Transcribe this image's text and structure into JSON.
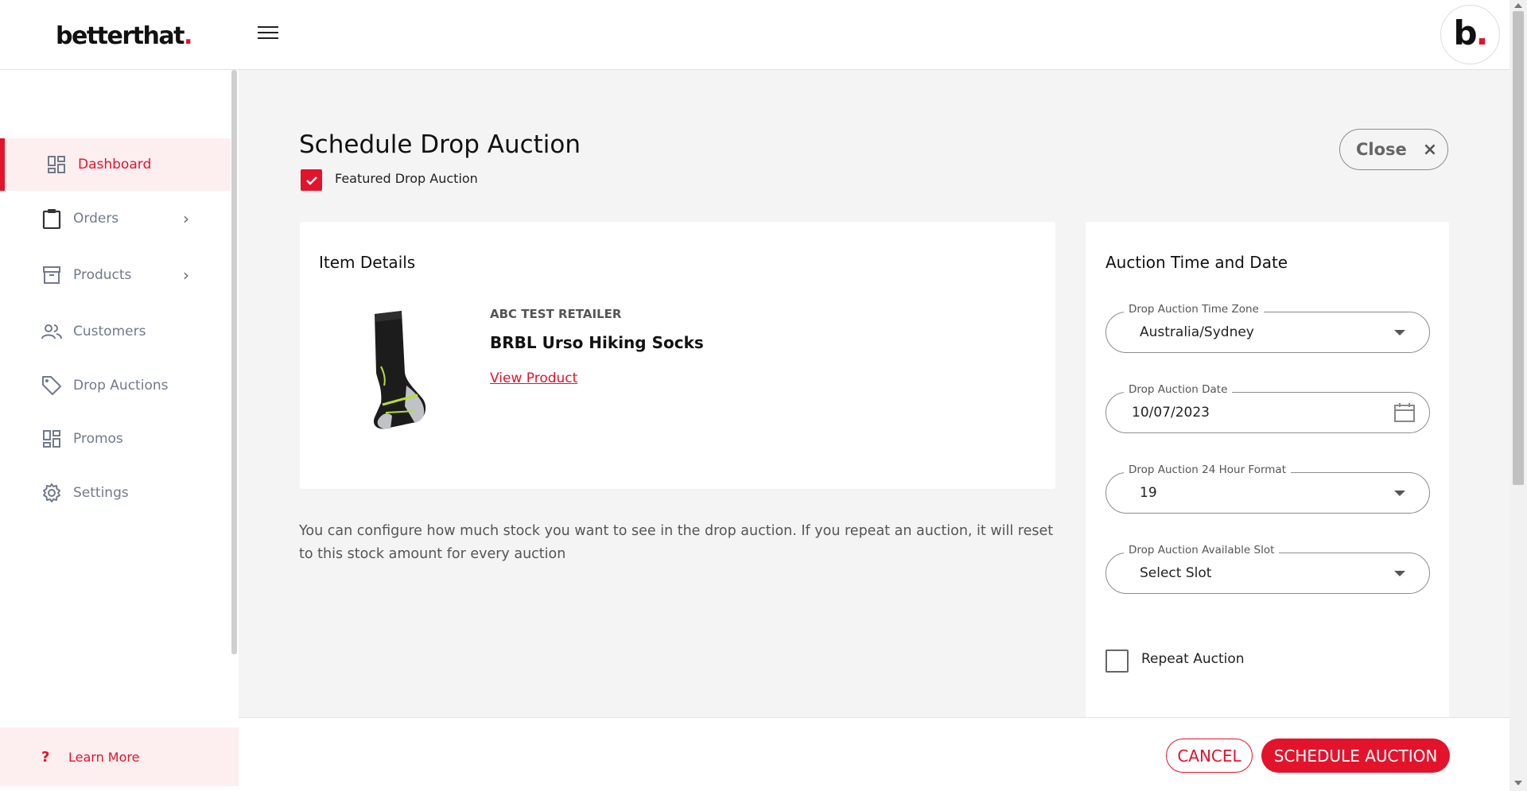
{
  "header": {
    "logo_text": "betterthat",
    "logo_dot": ".",
    "avatar_text": "b",
    "avatar_dot": "."
  },
  "sidebar": {
    "items": [
      {
        "label": "Dashboard",
        "icon": "dashboard-icon",
        "active": true
      },
      {
        "label": "Orders",
        "icon": "clipboard-icon",
        "has_submenu": true
      },
      {
        "label": "Products",
        "icon": "archive-box-icon",
        "has_submenu": true
      },
      {
        "label": "Customers",
        "icon": "people-icon"
      },
      {
        "label": "Drop Auctions",
        "icon": "tag-icon"
      },
      {
        "label": "Promos",
        "icon": "dashboard-icon"
      },
      {
        "label": "Settings",
        "icon": "gear-icon"
      }
    ],
    "chevron": "›",
    "learn_more": {
      "icon_text": "?",
      "label": "Learn More"
    }
  },
  "page": {
    "title": "Schedule Drop Auction",
    "featured_label": "Featured Drop Auction",
    "featured_checked": true,
    "close_label": "Close",
    "close_icon": "×"
  },
  "item_details": {
    "title": "Item Details",
    "retailer": "ABC TEST RETAILER",
    "product_name": "BRBL Urso Hiking Socks",
    "view_link": "View Product"
  },
  "help_text": "You can configure how much stock you want to see in the drop auction. If you repeat an auction, it will reset to this stock amount for every auction",
  "auction": {
    "title": "Auction Time and Date",
    "timezone": {
      "label": "Drop Auction Time Zone",
      "value": "Australia/Sydney"
    },
    "date": {
      "label": "Drop Auction Date",
      "value": "10/07/2023"
    },
    "hour": {
      "label": "Drop Auction 24 Hour Format",
      "value": "19"
    },
    "slot": {
      "label": "Drop Auction Available Slot",
      "value": "Select Slot"
    },
    "repeat_label": "Repeat Auction",
    "repeat_checked": false
  },
  "footer": {
    "cancel_label": "CANCEL",
    "schedule_label": "SCHEDULE AUCTION"
  },
  "colors": {
    "accent": "#e3132c",
    "sidebar_text": "#707a8a",
    "background": "#f4f4f4"
  }
}
